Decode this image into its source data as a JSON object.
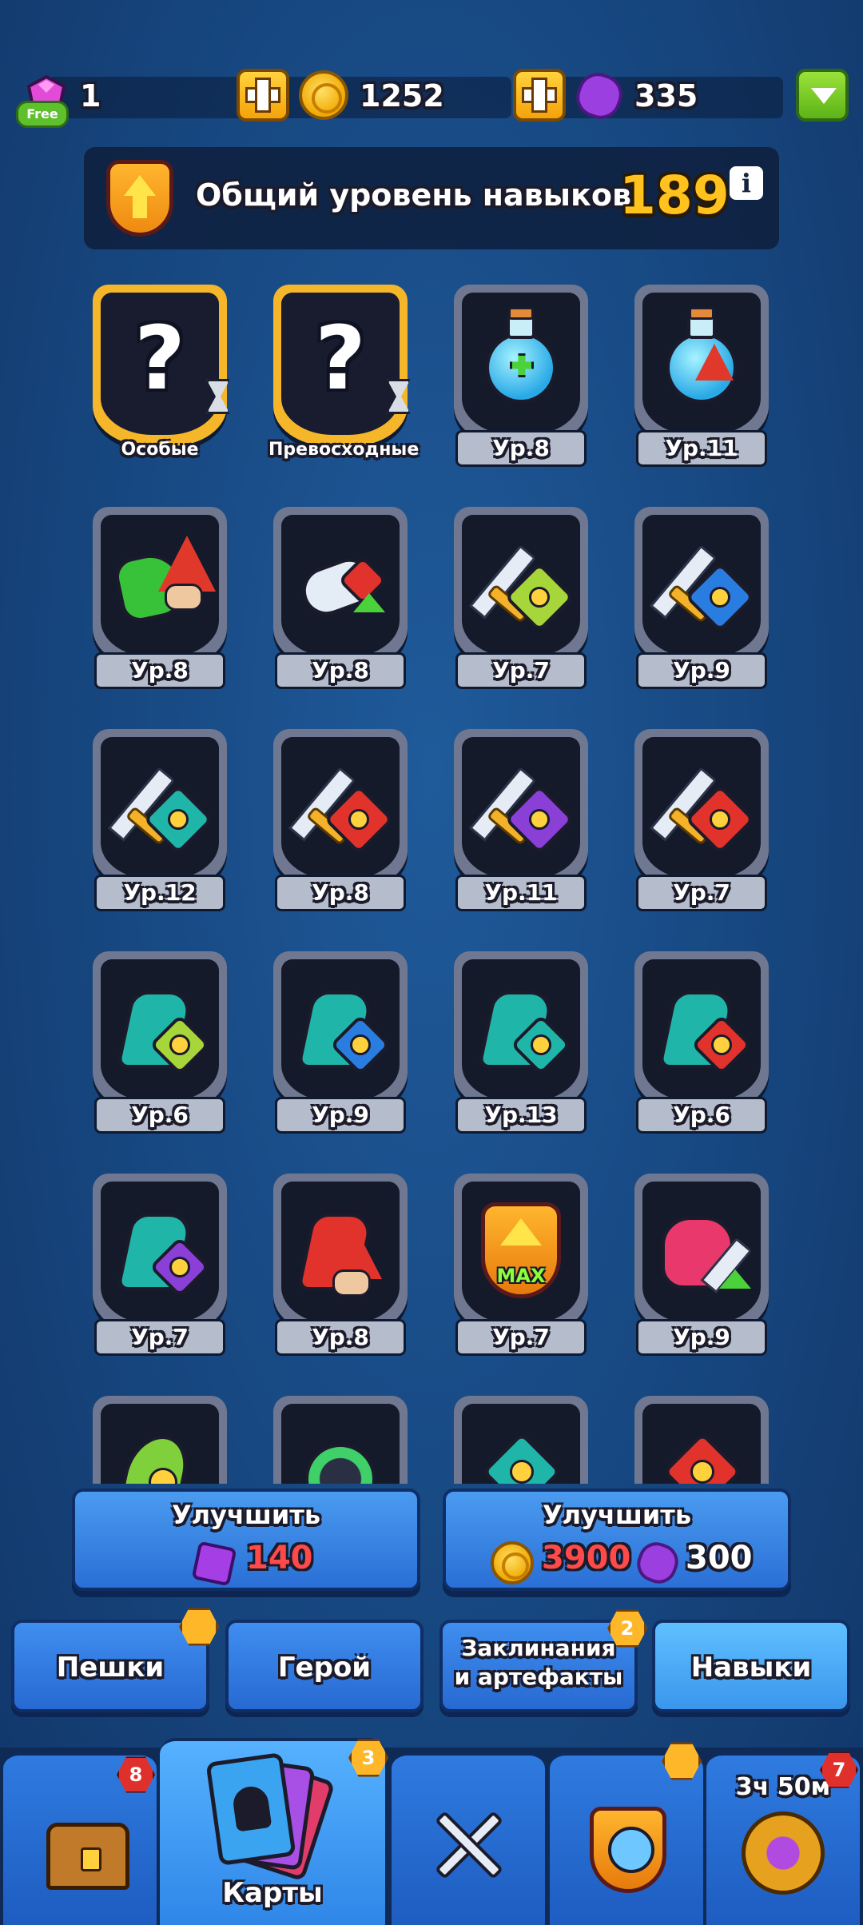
{
  "topbar": {
    "gems": "1",
    "free_label": "Free",
    "coins": "1252",
    "tokens": "335"
  },
  "skill_level": {
    "title": "Общий уровень навыков",
    "value": "189",
    "info_label": "i"
  },
  "skills": [
    {
      "caption": "Особые",
      "kind": "special"
    },
    {
      "caption": "Превосходные",
      "kind": "special"
    },
    {
      "level": "Ур.8",
      "art": "potion-green"
    },
    {
      "level": "Ур.11",
      "art": "potion-wizard"
    },
    {
      "level": "Ур.8",
      "art": "green-wizard"
    },
    {
      "level": "Ур.8",
      "art": "fist"
    },
    {
      "level": "Ур.7",
      "art": "sword-green"
    },
    {
      "level": "Ур.9",
      "art": "sword-blue"
    },
    {
      "level": "Ур.12",
      "art": "sword-teal"
    },
    {
      "level": "Ур.8",
      "art": "sword-red"
    },
    {
      "level": "Ур.11",
      "art": "sword-purple"
    },
    {
      "level": "Ур.7",
      "art": "sword-wizard"
    },
    {
      "level": "Ур.6",
      "art": "boot-green"
    },
    {
      "level": "Ур.9",
      "art": "boot-blue"
    },
    {
      "level": "Ур.13",
      "art": "boot-teal"
    },
    {
      "level": "Ур.6",
      "art": "boot-red"
    },
    {
      "level": "Ур.7",
      "art": "boot-purple"
    },
    {
      "level": "Ур.8",
      "art": "wizard-boot"
    },
    {
      "level": "Ур.7",
      "art": "max-shield",
      "max_label": "MAX"
    },
    {
      "level": "Ур.9",
      "art": "pink-monster"
    },
    {
      "level": "",
      "art": "hood-green"
    },
    {
      "level": "",
      "art": "ball-blue"
    },
    {
      "level": "",
      "art": "eagle-teal"
    },
    {
      "level": "",
      "art": "bulb-red"
    }
  ],
  "upgrade": {
    "left_label": "Улучшить",
    "left_cost": "140",
    "right_label": "Улучшить",
    "right_coin_cost": "3900",
    "right_token_cost": "300"
  },
  "categories": [
    {
      "label": "Пешки",
      "badge": ""
    },
    {
      "label": "Герой",
      "badge": ""
    },
    {
      "label": "Заклинания и артефакты",
      "line1": "Заклинания",
      "line2": "и артефакты",
      "badge": "2"
    },
    {
      "label": "Навыки",
      "badge": ""
    }
  ],
  "nav": {
    "chest_badge": "8",
    "cards_label": "Карты",
    "cards_badge": "3",
    "timer": "3ч 50м",
    "trophy_badge": "7"
  },
  "colors": {
    "accent_gold": "#ffc21f",
    "cost_red": "#ff4a4a",
    "button_blue": "#2a6fd6"
  }
}
